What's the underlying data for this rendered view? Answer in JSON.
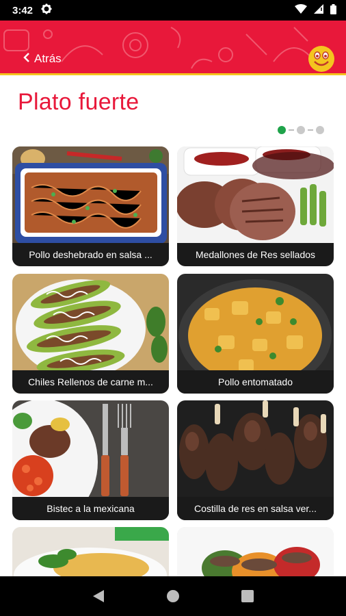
{
  "status_bar": {
    "time": "3:42"
  },
  "header": {
    "back_label": "Atrás",
    "accent_color": "#e8183a",
    "stripe_color": "#f4c51f"
  },
  "page": {
    "title": "Plato fuerte"
  },
  "pager": {
    "pages": 3,
    "active_index": 0,
    "active_color": "#1fa34a"
  },
  "dishes": [
    {
      "label": "Pollo deshebrado en salsa ..."
    },
    {
      "label": "Medallones de Res sellados"
    },
    {
      "label": "Chiles Rellenos de carne m..."
    },
    {
      "label": "Pollo entomatado"
    },
    {
      "label": "Bistec a la mexicana"
    },
    {
      "label": "Costilla de res en salsa ver..."
    },
    {
      "label": ""
    },
    {
      "label": ""
    }
  ],
  "nav": {
    "back_icon": "triangle-back-icon",
    "home_icon": "circle-home-icon",
    "recents_icon": "square-recents-icon"
  }
}
